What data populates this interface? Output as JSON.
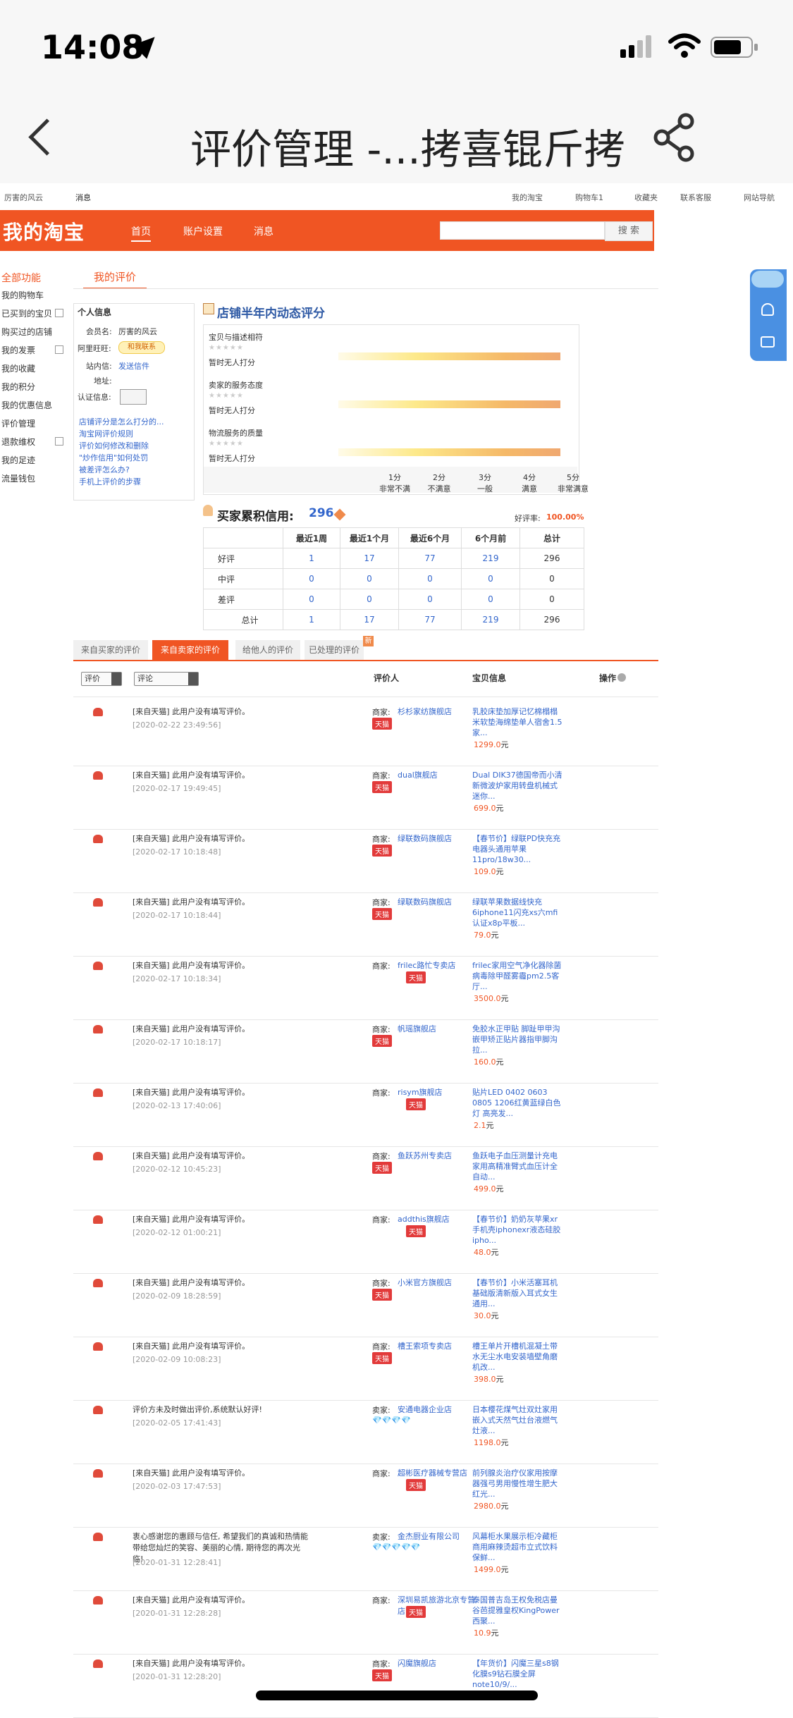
{
  "status": {
    "time": "14:08"
  },
  "nav": {
    "title": "评价管理 -...拷喜锟斤拷"
  },
  "topbar": {
    "user": "厉害的风云",
    "messages": "消息",
    "my_taobao": "我的淘宝",
    "cart": "购物车1",
    "favorites": "收藏夹",
    "service": "联系客服",
    "site_nav": "网站导航"
  },
  "banner": {
    "logo": "我的淘宝",
    "home": "首页",
    "account": "账户设置",
    "messages": "消息",
    "search_button": "搜 索"
  },
  "sidebar": {
    "title": "全部功能",
    "items": [
      "我的购物车",
      "已买到的宝贝",
      "购买过的店铺",
      "我的发票",
      "我的收藏",
      "我的积分",
      "我的优惠信息",
      "评价管理",
      "退款维权",
      "我的足迹",
      "流量钱包"
    ]
  },
  "tab": {
    "my_reviews": "我的评价"
  },
  "personal": {
    "title": "个人信息",
    "member_label": "会员名:",
    "member_value": "厉害的风云",
    "wangwang_label": "阿里旺旺:",
    "wangwang_value": "和我联系",
    "mail_label": "站内信:",
    "mail_value": "发送信件",
    "address_label": "地址:",
    "verify_label": "认证信息:",
    "links": [
      "店铺评分是怎么打分的...",
      "淘宝网评价规则",
      "评价如何修改和删除",
      "\"炒作信用\"如何处罚",
      "被差评怎么办?",
      "手机上评价的步骤"
    ]
  },
  "shop_rating": {
    "title": "店铺半年内动态评分",
    "items": [
      {
        "label": "宝贝与描述相符",
        "status": "暂时无人打分"
      },
      {
        "label": "卖家的服务态度",
        "status": "暂时无人打分"
      },
      {
        "label": "物流服务的质量",
        "status": "暂时无人打分"
      }
    ],
    "scale": [
      {
        "score": "1分",
        "desc": "非常不满"
      },
      {
        "score": "2分",
        "desc": "不满意"
      },
      {
        "score": "3分",
        "desc": "一般"
      },
      {
        "score": "4分",
        "desc": "满意"
      },
      {
        "score": "5分",
        "desc": "非常满意"
      }
    ]
  },
  "buyer_credit": {
    "title": "买家累积信用:",
    "score": "296",
    "good_rate_label": "好评率:",
    "good_rate": "100.00%",
    "headers": [
      "",
      "最近1周",
      "最近1个月",
      "最近6个月",
      "6个月前",
      "总计"
    ],
    "rows": [
      {
        "label": "好评",
        "values": [
          "1",
          "17",
          "77",
          "219",
          "296"
        ]
      },
      {
        "label": "中评",
        "values": [
          "0",
          "0",
          "0",
          "0",
          "0"
        ]
      },
      {
        "label": "差评",
        "values": [
          "0",
          "0",
          "0",
          "0",
          "0"
        ]
      },
      {
        "label": "总计",
        "values": [
          "1",
          "17",
          "77",
          "219",
          "296"
        ]
      }
    ]
  },
  "review_tabs": [
    "来自买家的评价",
    "来自卖家的评价",
    "给他人的评价",
    "已处理的评价"
  ],
  "review_tab_badge": "新",
  "list_header": {
    "filter1": "评价",
    "filter2": "评论",
    "reviewer": "评价人",
    "item": "宝贝信息",
    "action": "操作"
  },
  "reviews": [
    {
      "text": "[来自天猫] 此用户没有填写评价。",
      "date": "[2020-02-22 23:49:56]",
      "seller": "杉杉家纺旗舰店",
      "badge": "天猫",
      "item": "乳胶床垫加厚记忆棉榻榻米软垫海绵垫单人宿舍1.5家...",
      "price": "1299.0",
      "unit": "元",
      "role": "商家:"
    },
    {
      "text": "[来自天猫] 此用户没有填写评价。",
      "date": "[2020-02-17 19:49:45]",
      "seller": "dual旗舰店",
      "badge": "天猫",
      "item": "Dual DIK37德国帝而小清新微波炉家用转盘机械式迷你...",
      "price": "699.0",
      "unit": "元",
      "role": "商家:"
    },
    {
      "text": "[来自天猫] 此用户没有填写评价。",
      "date": "[2020-02-17 10:18:48]",
      "seller": "绿联数码旗舰店",
      "badge": "天猫",
      "item": "【春节价】绿联PD快充充电器头通用苹果11pro/18w30...",
      "price": "109.0",
      "unit": "元",
      "role": "商家:"
    },
    {
      "text": "[来自天猫] 此用户没有填写评价。",
      "date": "[2020-02-17 10:18:44]",
      "seller": "绿联数码旗舰店",
      "badge": "天猫",
      "item": "绿联苹果数据线快充6iphone11闪充xs六mfi认证x8p平板...",
      "price": "79.0",
      "unit": "元",
      "role": "商家:"
    },
    {
      "text": "[来自天猫] 此用户没有填写评价。",
      "date": "[2020-02-17 10:18:34]",
      "seller": "frilec路忙专卖店",
      "badge": "天猫",
      "item": "frilec家用空气净化器除菌病毒除甲醛雾霾pm2.5客厅...",
      "price": "3500.0",
      "unit": "元",
      "role": "商家:"
    },
    {
      "text": "[来自天猫] 此用户没有填写评价。",
      "date": "[2020-02-17 10:18:17]",
      "seller": "帆瑶旗舰店",
      "badge": "天猫",
      "item": "免胶水正甲贴 脚趾甲甲沟嵌甲矫正贴片器指甲脚沟拉...",
      "price": "160.0",
      "unit": "元",
      "role": "商家:"
    },
    {
      "text": "[来自天猫] 此用户没有填写评价。",
      "date": "[2020-02-13 17:40:06]",
      "seller": "risym旗舰店",
      "badge": "天猫",
      "item": "贴片LED 0402 0603 0805 1206红黄蓝绿白色灯 高亮发...",
      "price": "2.1",
      "unit": "元",
      "role": "商家:"
    },
    {
      "text": "[来自天猫] 此用户没有填写评价。",
      "date": "[2020-02-12 10:45:23]",
      "seller": "鱼跃苏州专卖店",
      "badge": "天猫",
      "item": "鱼跃电子血压测量计充电家用高精准臂式血压计全自动...",
      "price": "499.0",
      "unit": "元",
      "role": "商家:"
    },
    {
      "text": "[来自天猫] 此用户没有填写评价。",
      "date": "[2020-02-12 01:00:21]",
      "seller": "addthis旗舰店",
      "badge": "天猫",
      "item": "【春节价】奶奶灰苹果xr手机壳iphonexr液态硅胶ipho...",
      "price": "48.0",
      "unit": "元",
      "role": "商家:"
    },
    {
      "text": "[来自天猫] 此用户没有填写评价。",
      "date": "[2020-02-09 18:28:59]",
      "seller": "小米官方旗舰店",
      "badge": "天猫",
      "item": "【春节价】小米活塞耳机 基础版清新版入耳式女生通用...",
      "price": "30.0",
      "unit": "元",
      "role": "商家:"
    },
    {
      "text": "[来自天猫] 此用户没有填写评价。",
      "date": "[2020-02-09 10:08:23]",
      "seller": "槽王索项专卖店",
      "badge": "天猫",
      "item": "槽王单片开槽机混凝土带水无尘水电安装墙壁角磨机改...",
      "price": "398.0",
      "unit": "元",
      "role": "商家:"
    },
    {
      "text": "评价方未及时做出评价,系统默认好评!",
      "date": "[2020-02-05 17:41:43]",
      "seller": "安通电器企业店",
      "badge": "",
      "item": "日本樱花煤气灶双灶家用嵌入式天然气灶台液燃气灶液...",
      "price": "1198.0",
      "unit": "元",
      "role": "卖家:",
      "diamonds": "💎💎💎💎"
    },
    {
      "text": "[来自天猫] 此用户没有填写评价。",
      "date": "[2020-02-03 17:47:53]",
      "seller": "超彬医疗器械专营店",
      "badge": "天猫",
      "item": "前列腺炎治疗仪家用按摩器强弓男用慢性增生肥大红光...",
      "price": "2980.0",
      "unit": "元",
      "role": "商家:"
    },
    {
      "text": "衷心感谢您的惠顾与信任, 希望我们的真诚和热情能带给您灿烂的笑容、美丽的心情, 期待您的再次光临!",
      "date": "[2020-01-31 12:28:41]",
      "seller": "金杰厨业有限公司",
      "badge": "",
      "item": "风幕柜水果展示柜冷藏柜商用麻辣烫超市立式饮料保鲜...",
      "price": "1499.0",
      "unit": "元",
      "role": "卖家:",
      "diamonds": "💎💎💎💎💎"
    },
    {
      "text": "[来自天猫] 此用户没有填写评价。",
      "date": "[2020-01-31 12:28:28]",
      "seller": "深圳易凯旅游北京专营店",
      "badge": "天猫",
      "item": "泰国普吉岛王权免税店曼谷芭提雅皇权KingPower西聚...",
      "price": "10.9",
      "unit": "元",
      "role": "商家:"
    },
    {
      "text": "[来自天猫] 此用户没有填写评价。",
      "date": "[2020-01-31 12:28:20]",
      "seller": "闪魔旗舰店",
      "badge": "天猫",
      "item": "【年货价】闪魔三星s8钢化膜s9钻石膜全屏note10/9/...",
      "price": "",
      "unit": "",
      "role": "商家:"
    }
  ]
}
